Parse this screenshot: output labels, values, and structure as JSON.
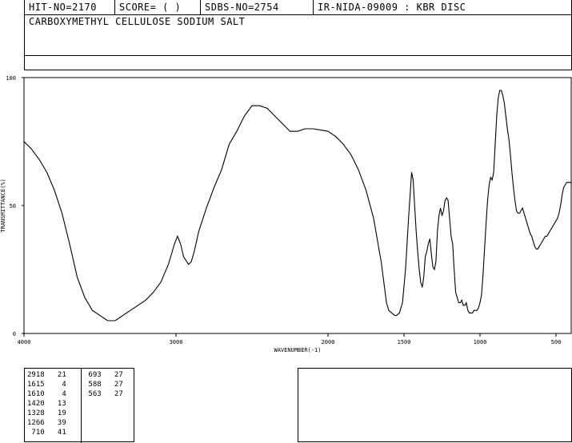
{
  "header": {
    "hit_no": "HIT-NO=2170",
    "score": "SCORE=  (   )",
    "sdbs_no": "SDBS-NO=2754",
    "source": "IR-NIDA-09009 : KBR DISC"
  },
  "compound_name": "CARBOXYMETHYL CELLULOSE SODIUM SALT",
  "chart_data": {
    "type": "line",
    "xlabel": "WAVENUMBER(-1)",
    "ylabel": "TRANSMITTANCE(%)",
    "xlim": [
      4000,
      400
    ],
    "ylim": [
      0,
      100
    ],
    "x_ticks": [
      4000,
      3000,
      2000,
      1500,
      1000,
      500
    ],
    "y_ticks": [
      0,
      50,
      100
    ],
    "x_tick_labels": [
      "4000",
      "3000",
      "2000",
      "1500",
      "1000",
      "500"
    ],
    "y_tick_labels": [
      "0",
      "50",
      "100"
    ],
    "grid": false,
    "series": [
      {
        "values": [
          [
            4000,
            75
          ],
          [
            3950,
            72
          ],
          [
            3900,
            68
          ],
          [
            3850,
            63
          ],
          [
            3800,
            56
          ],
          [
            3750,
            47
          ],
          [
            3700,
            35
          ],
          [
            3650,
            22
          ],
          [
            3600,
            14
          ],
          [
            3550,
            9
          ],
          [
            3500,
            7
          ],
          [
            3450,
            5
          ],
          [
            3400,
            5
          ],
          [
            3350,
            7
          ],
          [
            3300,
            9
          ],
          [
            3250,
            11
          ],
          [
            3200,
            13
          ],
          [
            3150,
            16
          ],
          [
            3100,
            20
          ],
          [
            3050,
            27
          ],
          [
            3010,
            35
          ],
          [
            2990,
            38
          ],
          [
            2970,
            35
          ],
          [
            2950,
            30
          ],
          [
            2918,
            27
          ],
          [
            2900,
            28
          ],
          [
            2880,
            32
          ],
          [
            2850,
            40
          ],
          [
            2800,
            49
          ],
          [
            2750,
            57
          ],
          [
            2700,
            64
          ],
          [
            2650,
            74
          ],
          [
            2600,
            79
          ],
          [
            2550,
            85
          ],
          [
            2500,
            89
          ],
          [
            2450,
            89
          ],
          [
            2400,
            88
          ],
          [
            2350,
            85
          ],
          [
            2300,
            82
          ],
          [
            2250,
            79
          ],
          [
            2200,
            79
          ],
          [
            2150,
            80
          ],
          [
            2100,
            80
          ],
          [
            2050,
            79.5
          ],
          [
            2000,
            79
          ],
          [
            1950,
            77
          ],
          [
            1900,
            74
          ],
          [
            1850,
            70
          ],
          [
            1800,
            64
          ],
          [
            1750,
            56
          ],
          [
            1700,
            45
          ],
          [
            1650,
            28
          ],
          [
            1615,
            12
          ],
          [
            1600,
            9
          ],
          [
            1580,
            8
          ],
          [
            1560,
            7
          ],
          [
            1550,
            7
          ],
          [
            1530,
            8
          ],
          [
            1510,
            12
          ],
          [
            1490,
            25
          ],
          [
            1470,
            45
          ],
          [
            1450,
            63
          ],
          [
            1440,
            60
          ],
          [
            1430,
            50
          ],
          [
            1420,
            40
          ],
          [
            1410,
            32
          ],
          [
            1400,
            25
          ],
          [
            1390,
            20
          ],
          [
            1380,
            18
          ],
          [
            1370,
            22
          ],
          [
            1360,
            30
          ],
          [
            1350,
            32
          ],
          [
            1340,
            35
          ],
          [
            1330,
            37
          ],
          [
            1320,
            31
          ],
          [
            1310,
            26
          ],
          [
            1300,
            25
          ],
          [
            1290,
            28
          ],
          [
            1280,
            40
          ],
          [
            1270,
            46
          ],
          [
            1260,
            49
          ],
          [
            1250,
            46
          ],
          [
            1240,
            48
          ],
          [
            1230,
            52
          ],
          [
            1220,
            53
          ],
          [
            1210,
            52
          ],
          [
            1200,
            45
          ],
          [
            1190,
            38
          ],
          [
            1180,
            35
          ],
          [
            1170,
            25
          ],
          [
            1160,
            16
          ],
          [
            1150,
            14
          ],
          [
            1140,
            12
          ],
          [
            1130,
            12
          ],
          [
            1120,
            13
          ],
          [
            1110,
            11
          ],
          [
            1100,
            11
          ],
          [
            1090,
            12
          ],
          [
            1080,
            9
          ],
          [
            1070,
            8
          ],
          [
            1060,
            8
          ],
          [
            1050,
            8
          ],
          [
            1040,
            9
          ],
          [
            1030,
            9
          ],
          [
            1020,
            9
          ],
          [
            1010,
            10
          ],
          [
            1000,
            12
          ],
          [
            990,
            15
          ],
          [
            980,
            23
          ],
          [
            970,
            33
          ],
          [
            960,
            43
          ],
          [
            950,
            52
          ],
          [
            940,
            58
          ],
          [
            930,
            61
          ],
          [
            920,
            60
          ],
          [
            910,
            63
          ],
          [
            900,
            74
          ],
          [
            890,
            85
          ],
          [
            880,
            92
          ],
          [
            870,
            95
          ],
          [
            860,
            95
          ],
          [
            850,
            93
          ],
          [
            840,
            90
          ],
          [
            830,
            85
          ],
          [
            820,
            80
          ],
          [
            810,
            76
          ],
          [
            800,
            70
          ],
          [
            790,
            63
          ],
          [
            780,
            57
          ],
          [
            770,
            52
          ],
          [
            760,
            48
          ],
          [
            750,
            47
          ],
          [
            740,
            47
          ],
          [
            730,
            48
          ],
          [
            720,
            49
          ],
          [
            710,
            47
          ],
          [
            700,
            45
          ],
          [
            690,
            43
          ],
          [
            680,
            41
          ],
          [
            670,
            39
          ],
          [
            660,
            38
          ],
          [
            650,
            36
          ],
          [
            640,
            34
          ],
          [
            630,
            33
          ],
          [
            620,
            33
          ],
          [
            610,
            34
          ],
          [
            600,
            35
          ],
          [
            590,
            36
          ],
          [
            580,
            37
          ],
          [
            570,
            38
          ],
          [
            560,
            38
          ],
          [
            550,
            39
          ],
          [
            540,
            40
          ],
          [
            530,
            41
          ],
          [
            520,
            42
          ],
          [
            510,
            43
          ],
          [
            500,
            44
          ],
          [
            490,
            45
          ],
          [
            480,
            47
          ],
          [
            470,
            50
          ],
          [
            460,
            54
          ],
          [
            450,
            57
          ],
          [
            440,
            58
          ],
          [
            430,
            59
          ],
          [
            420,
            59
          ],
          [
            410,
            59
          ],
          [
            400,
            59
          ]
        ]
      }
    ],
    "peak_table": [
      [
        "2918",
        "21"
      ],
      [
        "1615",
        "4"
      ],
      [
        "1610",
        "4"
      ],
      [
        "1420",
        "13"
      ],
      [
        "1328",
        "19"
      ],
      [
        "1266",
        "39"
      ],
      [
        "710",
        "41"
      ],
      [
        "693",
        "27"
      ],
      [
        "588",
        "27"
      ],
      [
        "563",
        "27"
      ]
    ]
  }
}
